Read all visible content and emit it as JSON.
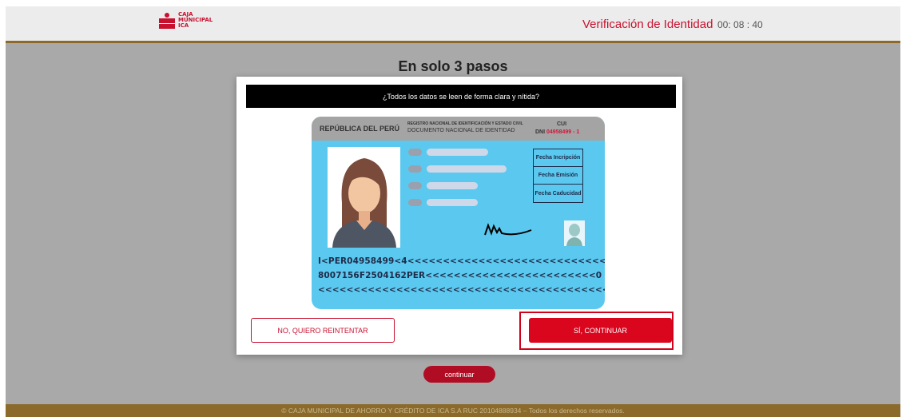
{
  "header": {
    "logo_lines": [
      "CAJA",
      "MUNICIPAL",
      "ICA"
    ],
    "title": "Verificación de Identidad",
    "timer": "00: 08 : 40"
  },
  "main": {
    "steps_title": "En solo 3 pasos",
    "continue_label": "continuar"
  },
  "modal": {
    "question": "¿Todos los datos se leen de forma clara y nítida?",
    "card": {
      "country": "REPÚBLICA DEL PERÚ",
      "registry": "REGISTRO NACIONAL DE IDENTIFICACIÓN Y ESTADO CIVIL",
      "document": "DOCUMENTO NACIONAL DE IDENTIDAD",
      "cui_label": "CUI",
      "dni_label": "DNI",
      "dni_number": "04958499 - 1",
      "date_labels": [
        "Fecha Incripción",
        "Fecha Emisión",
        "Fecha Caducidad"
      ],
      "mrz": [
        "I<PER04958499<4<<<<<<<<<<<<<<<<<<<<<<<<<<<<",
        "8007156F2504162PER<<<<<<<<<<<<<<<<<<<<<<<<0",
        "<<<<<<<<<<<<<<<<<<<<<<<<<<<<<<<<<<<<<<<<<<<<<"
      ]
    },
    "retry_label": "NO, QUIERO REINTENTAR",
    "confirm_label": "SÍ, CONTINUAR"
  },
  "footer": {
    "text": "© CAJA MUNICIPAL DE AHORRO Y CRÉDITO DE ICA S.A RUC 20104888934 – Todos los derechos reservados."
  },
  "colors": {
    "brand_red": "#c8102e",
    "header_bg": "#ececec",
    "overlay": "#a9a9a9",
    "footer_bg": "#8b6a2b",
    "card_blue": "#5bc9ef"
  }
}
